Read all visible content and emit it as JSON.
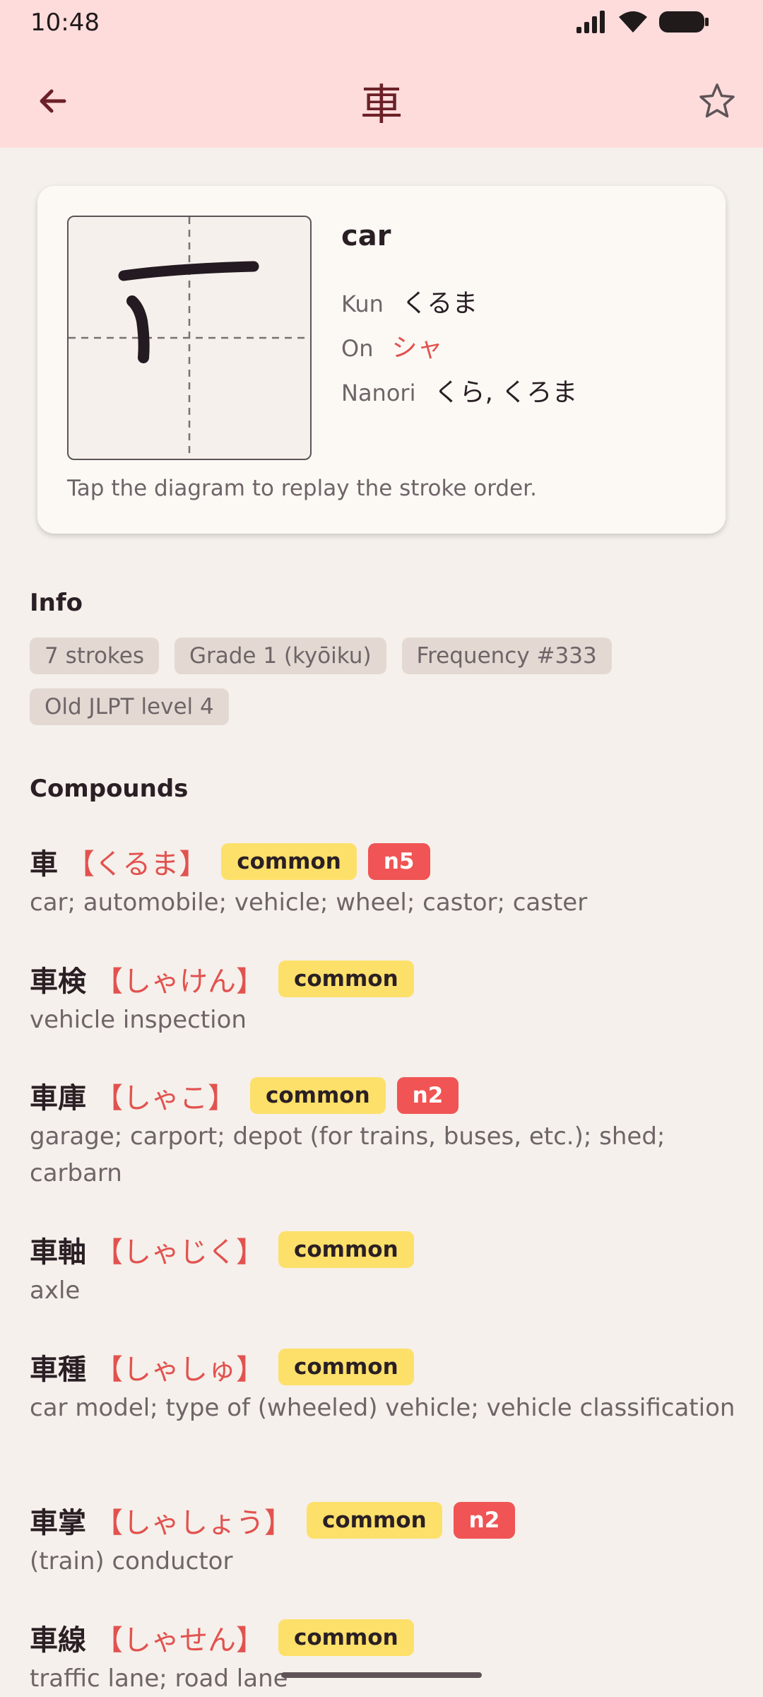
{
  "status": {
    "time": "10:48"
  },
  "header": {
    "title": "車"
  },
  "card": {
    "meaning": "car",
    "kun_label": "Kun",
    "kun": "くるま",
    "on_label": "On",
    "on": "シャ",
    "nanori_label": "Nanori",
    "nanori": "くら, くろま",
    "hint": "Tap the diagram to replay the stroke order."
  },
  "info": {
    "title": "Info",
    "chips": [
      "7 strokes",
      "Grade 1 (kyōiku)",
      "Frequency #333",
      "Old JLPT level 4"
    ]
  },
  "compounds": {
    "title": "Compounds",
    "items": [
      {
        "word": "車",
        "reading": "【くるま】",
        "tags": [
          "common",
          "n5"
        ],
        "gloss": "car; automobile; vehicle; wheel; castor; caster"
      },
      {
        "word": "車検",
        "reading": "【しゃけん】",
        "tags": [
          "common"
        ],
        "gloss": "vehicle inspection"
      },
      {
        "word": "車庫",
        "reading": "【しゃこ】",
        "tags": [
          "common",
          "n2"
        ],
        "gloss": "garage; carport; depot (for trains, buses, etc.); shed; carbarn"
      },
      {
        "word": "車軸",
        "reading": "【しゃじく】",
        "tags": [
          "common"
        ],
        "gloss": "axle"
      },
      {
        "word": "車種",
        "reading": "【しゃしゅ】",
        "tags": [
          "common"
        ],
        "gloss": "car model; type of (wheeled) vehicle; vehicle classification"
      },
      {
        "word": "車掌",
        "reading": "【しゃしょう】",
        "tags": [
          "common",
          "n2"
        ],
        "gloss": "(train) conductor"
      },
      {
        "word": "車線",
        "reading": "【しゃせん】",
        "tags": [
          "common"
        ],
        "gloss": "traffic lane; road lane"
      }
    ]
  },
  "colors": {
    "appbar": "#ffdcdc",
    "accent": "#e2524f",
    "common_tag": "#fde06a",
    "jlpt_tag": "#f05454"
  }
}
